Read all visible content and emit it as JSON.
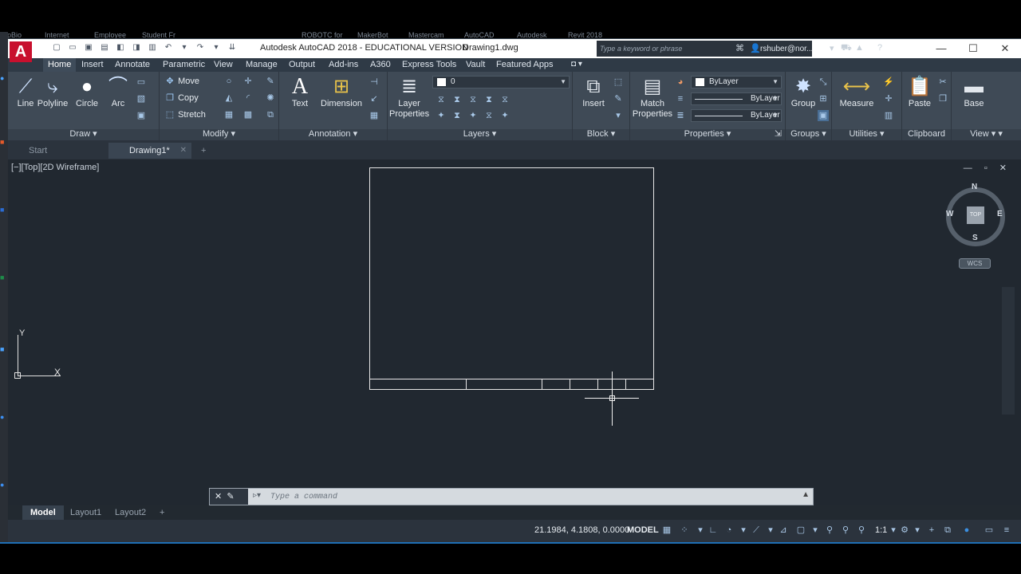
{
  "background_tabs": [
    "ycpBio",
    "Internet",
    "Employee",
    "Student Fr",
    "ROBOTC for",
    "MakerBot",
    "Mastercam",
    "AutoCAD",
    "Autodesk",
    "Revit 2018"
  ],
  "window": {
    "title": "Autodesk AutoCAD 2018 - EDUCATIONAL VERSION",
    "file": "Drawing1.dwg",
    "app_button": "A",
    "search_placeholder": "Type a keyword or phrase",
    "user": "rshuber@nor...",
    "minimize": "—",
    "maximize": "☐",
    "close": "✕"
  },
  "ribbon_tabs": [
    "Home",
    "Insert",
    "Annotate",
    "Parametric",
    "View",
    "Manage",
    "Output",
    "Add-ins",
    "A360",
    "Express Tools",
    "Vault",
    "Featured Apps"
  ],
  "ribbon": {
    "draw": {
      "title": "Draw",
      "line": "Line",
      "polyline": "Polyline",
      "circle": "Circle",
      "arc": "Arc"
    },
    "modify": {
      "title": "Modify",
      "move": "Move",
      "copy": "Copy",
      "stretch": "Stretch"
    },
    "annotation": {
      "title": "Annotation",
      "text": "Text",
      "dimension": "Dimension"
    },
    "layers": {
      "title": "Layers",
      "layer_properties": "Layer\nProperties",
      "layer_value": "0"
    },
    "block": {
      "title": "Block",
      "insert": "Insert"
    },
    "properties": {
      "title": "Properties",
      "match": "Match\nProperties",
      "color": "ByLayer",
      "linetype": "ByLayer",
      "lineweight": "ByLayer"
    },
    "groups": {
      "title": "Groups",
      "group": "Group"
    },
    "utilities": {
      "title": "Utilities",
      "measure": "Measure"
    },
    "clipboard": {
      "title": "Clipboard",
      "paste": "Paste"
    },
    "view": {
      "title": "View",
      "base": "Base"
    }
  },
  "file_tabs": {
    "start": "Start",
    "drawing": "Drawing1*",
    "add": "+"
  },
  "viewport": {
    "label": "[−][Top][2D Wireframe]",
    "controls": "— ▫ ✕",
    "viewcube": {
      "n": "N",
      "s": "S",
      "e": "E",
      "w": "W",
      "top": "TOP"
    },
    "wcs": "WCS",
    "ucs_x": "X",
    "ucs_y": "Y"
  },
  "command": {
    "placeholder": "Type a command",
    "close": "✕",
    "tools": "🔧"
  },
  "layout_tabs": [
    "Model",
    "Layout1",
    "Layout2",
    "+"
  ],
  "status": {
    "coords": "21.1984, 4.1808, 0.0000",
    "model": "MODEL",
    "scale": "1:1"
  },
  "colors": {
    "app_red": "#c8102e",
    "ribbon": "#3f4a56",
    "canvas": "#212830",
    "accent_blue": "#1f6fb5"
  }
}
